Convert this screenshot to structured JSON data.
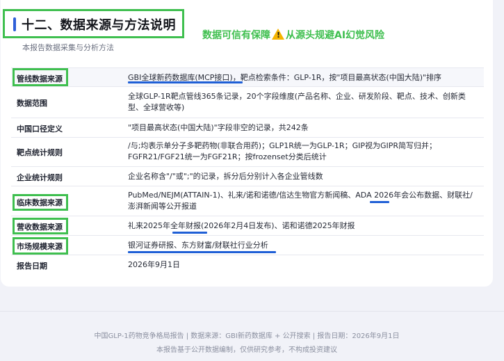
{
  "section": {
    "title": "十二、数据来源与方法说明",
    "subtitle": "本报告数据采集与分析方法",
    "banner_before": "数据可信有保障",
    "banner_after": "从源头规避AI幻觉风险",
    "accent_color": "#2f5fd8",
    "highlight_color": "#3fbf4f",
    "underline_color": "#1f5fd6",
    "warning_icon": "warning-triangle-icon"
  },
  "rows": [
    {
      "label": "管线数据来源",
      "value": "GBI全球新药数据库(MCP接口)，靶点检索条件：GLP-1R，按\"项目最高状态(中国大陆)\"排序"
    },
    {
      "label": "数据范围",
      "value": "全球GLP-1R靶点管线365条记录，20个字段维度(产品名称、企业、研发阶段、靶点、技术、创新类型、全球营收等)"
    },
    {
      "label": "中国口径定义",
      "value": "\"项目最高状态(中国大陆)\"字段非空的记录，共242条"
    },
    {
      "label": "靶点统计规则",
      "value": "/与;均表示单分子多靶药物(非联合用药)；GLP1R统一为GLP-1R；GIP视为GIPR简写归并；FGFR21/FGF21统一为FGF21R；按frozenset分类后统计"
    },
    {
      "label": "企业统计规则",
      "value": "企业名称含\"/\"或\";\"的记录，拆分后分别计入各企业管线数"
    },
    {
      "label": "临床数据来源",
      "value": "PubMed/NEJM(ATTAIN-1)、礼来/诺和诺德/信达生物官方新闻稿、ADA 2026年会公布数据、财联社/澎湃新闻等公开报道"
    },
    {
      "label": "营收数据来源",
      "value": "礼来2025年全年财报(2026年2月4日发布)、诺和诺德2025年财报"
    },
    {
      "label": "市场规模来源",
      "value": "银河证券研报、东方财富/财联社行业分析"
    },
    {
      "label": "报告日期",
      "value": "2026年9月1日"
    }
  ],
  "footer": {
    "line1": "中国GLP-1药物竞争格局报告 | 数据来源：GBI新药数据库 + 公开搜索 | 报告日期：2026年9月1日",
    "line2": "本报告基于公开数据编制，仅供研究参考，不构成投资建议"
  }
}
